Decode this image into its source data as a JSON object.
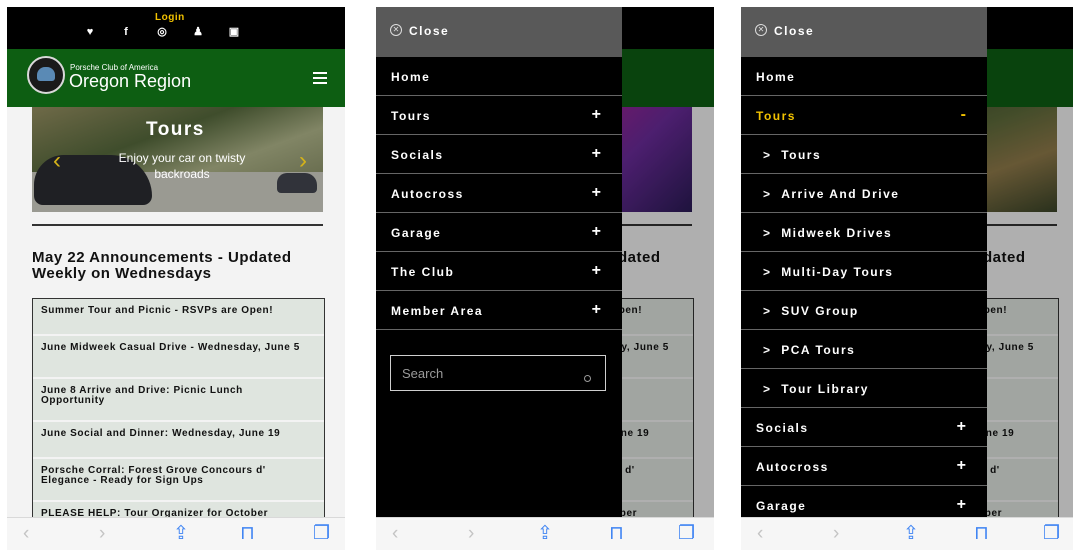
{
  "site": {
    "login": "Login",
    "brand_small": "Porsche Club of America",
    "brand_big": "Oregon Region",
    "slide_title": "Tours",
    "slide_sub": "Enjoy your car on twisty backroads",
    "heading": "May 22 Announcements - Updated Weekly on Wednesdays",
    "announcements": [
      "Summer Tour and Picnic - RSVPs are Open!",
      "June Midweek Casual Drive - Wednesday, June 5",
      "June 8 Arrive and Drive: Picnic Lunch Opportunity",
      "June Social and Dinner: Wednesday, June 19",
      "Porsche Corral: Forest Grove Concours d' Elegance - Ready for Sign Ups",
      "PLEASE HELP: Tour Organizer for October Arrive and Drive"
    ]
  },
  "menu": {
    "close_label": "Close",
    "items": [
      "Home",
      "Tours",
      "Socials",
      "Autocross",
      "Garage",
      "The Club",
      "Member Area"
    ],
    "search_placeholder": "Search",
    "tours_sub": [
      "Tours",
      "Arrive And Drive",
      "Midweek Drives",
      "Multi-Day Tours",
      "SUV Group",
      "PCA Tours",
      "Tour Library"
    ],
    "plus": "+",
    "minus": "-",
    "chevron": ">"
  },
  "colors": {
    "accent": "#f2c200",
    "brand_green": "#0d5e12",
    "ios_blue": "#3f84f3"
  }
}
